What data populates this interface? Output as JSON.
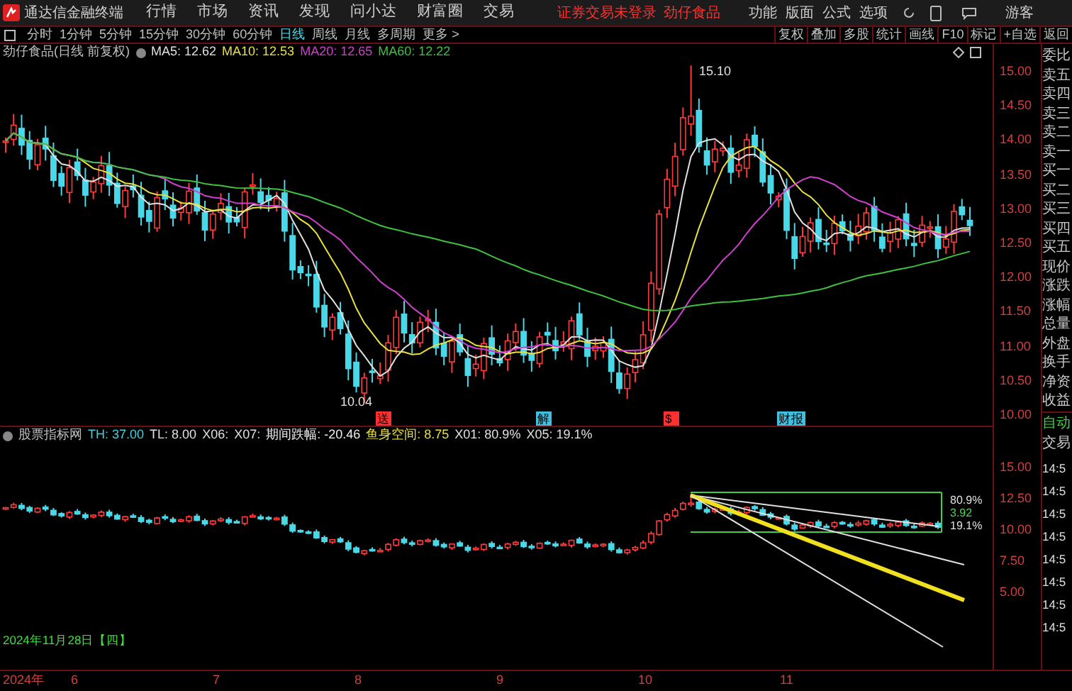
{
  "app": {
    "title": "通达信金融终端",
    "menu": [
      "行情",
      "市场",
      "资讯",
      "发现",
      "问小达",
      "财富圈",
      "交易"
    ],
    "notice": "证券交易未登录",
    "stock": "劲仔食品",
    "actions": [
      "功能",
      "版面",
      "公式",
      "选项"
    ],
    "user": "游客"
  },
  "periods": [
    {
      "label": "分时",
      "selected": false
    },
    {
      "label": "1分钟",
      "selected": false
    },
    {
      "label": "5分钟",
      "selected": false
    },
    {
      "label": "15分钟",
      "selected": false
    },
    {
      "label": "30分钟",
      "selected": false
    },
    {
      "label": "60分钟",
      "selected": false
    },
    {
      "label": "日线",
      "selected": true
    },
    {
      "label": "周线",
      "selected": false
    },
    {
      "label": "月线",
      "selected": false
    },
    {
      "label": "多周期",
      "selected": false
    },
    {
      "label": "更多 >",
      "selected": false
    }
  ],
  "tools": [
    "复权",
    "叠加",
    "多股",
    "统计",
    "画线",
    "F10",
    "标记",
    "+自选",
    "返回"
  ],
  "main_chart": {
    "title": "劲仔食品(日线 前复权)",
    "ma": [
      {
        "label": "MA5: 12.62",
        "color": "#e0e0e0"
      },
      {
        "label": "MA10: 12.53",
        "color": "#e8e040"
      },
      {
        "label": "MA20: 12.65",
        "color": "#d040d0"
      },
      {
        "label": "MA60: 12.22",
        "color": "#40c040"
      }
    ],
    "high_label": "15.10",
    "low_label": "10.04",
    "events": [
      {
        "label": "送",
        "color": "#ff3030"
      },
      {
        "label": "解",
        "color": "#40c0e0"
      },
      {
        "label": "$",
        "color": "#ff3030"
      },
      {
        "label": "财报",
        "color": "#40c0e0"
      }
    ],
    "y_axis": [
      "15.00",
      "14.50",
      "14.00",
      "13.50",
      "13.00",
      "12.50",
      "12.00",
      "11.50",
      "11.00",
      "10.50",
      "10.00"
    ]
  },
  "indicator": {
    "name": "股票指标网",
    "values": [
      {
        "label": "TH: 37.00",
        "color": "#40d0e0"
      },
      {
        "label": "TL: 8.00",
        "color": "#e0e0e0"
      },
      {
        "label": "X06:",
        "color": "#e0e0e0"
      },
      {
        "label": "X07:",
        "color": "#e0e0e0"
      },
      {
        "label": "期间跌幅: -20.46",
        "color": "#f0f0f0"
      },
      {
        "label": "鱼身空间: 8.75",
        "color": "#e8e040"
      },
      {
        "label": "X01: 80.9%",
        "color": "#e0e0e0"
      },
      {
        "label": "X05: 19.1%",
        "color": "#e0e0e0"
      }
    ],
    "tags": [
      "80.9%",
      "3.92",
      "19.1%"
    ],
    "y_axis": [
      "15.00",
      "12.50",
      "10.00",
      "7.50",
      "5.00"
    ]
  },
  "cursor_date": "2024年11月28日【四】",
  "x_axis": [
    "2024年",
    "6",
    "7",
    "8",
    "9",
    "10",
    "11"
  ],
  "quote_panel": [
    "委比",
    "卖五",
    "卖四",
    "卖三",
    "卖二",
    "卖一",
    "买一",
    "买二",
    "买三",
    "买四",
    "买五",
    "现价",
    "涨跌",
    "涨幅",
    "总量",
    "外盘",
    "换手",
    "净资",
    "收益"
  ],
  "auto": "自动",
  "trade": "交易",
  "times": [
    "14:5",
    "14:5",
    "14:5",
    "14:5",
    "14:5",
    "14:5",
    "14:5",
    "14:5"
  ]
}
